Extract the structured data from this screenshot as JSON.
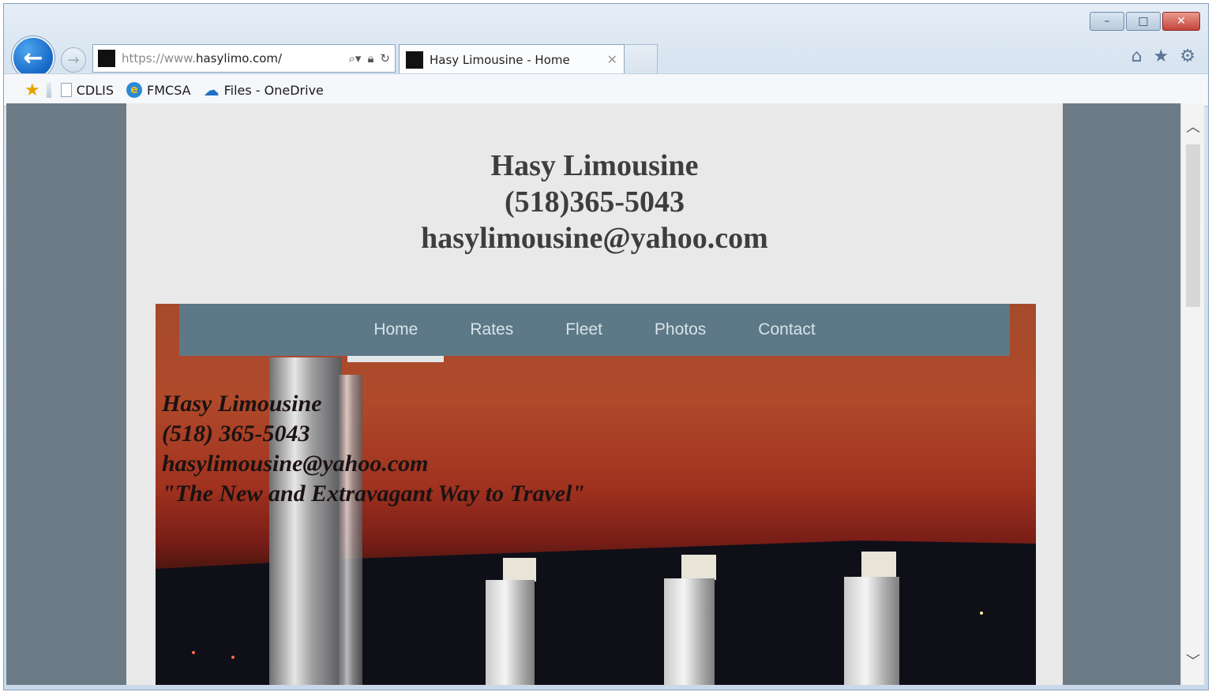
{
  "browser": {
    "url_prefix": "https://www.",
    "url_domain": "hasylimo.com/",
    "tab_title": "Hasy Limousine - Home",
    "favorites": [
      {
        "label": "CDLIS"
      },
      {
        "label": "FMCSA"
      },
      {
        "label": "Files - OneDrive"
      }
    ],
    "icons": {
      "back": "back-arrow-icon",
      "forward": "forward-arrow-icon",
      "search": "search-icon",
      "lock": "lock-icon",
      "refresh": "refresh-icon",
      "home": "home-icon",
      "favorites": "star-icon",
      "settings": "gear-icon"
    }
  },
  "site": {
    "header": {
      "name": "Hasy Limousine",
      "phone": "(518)365-5043",
      "email": "hasylimousine@yahoo.com"
    },
    "nav": [
      {
        "label": "Home",
        "active": true
      },
      {
        "label": "Rates"
      },
      {
        "label": "Fleet"
      },
      {
        "label": "Photos"
      },
      {
        "label": "Contact"
      }
    ],
    "hero_text": {
      "name": "Hasy Limousine",
      "phone": "(518) 365-5043",
      "email": "hasylimousine@yahoo.com",
      "tagline": "\"The New and Extravagant Way to Travel\""
    }
  },
  "colors": {
    "nav_bg": "#5d7886",
    "page_bg": "#e9e9e9",
    "side_bg": "#6c7b86",
    "header_text": "#3e3e3e"
  }
}
